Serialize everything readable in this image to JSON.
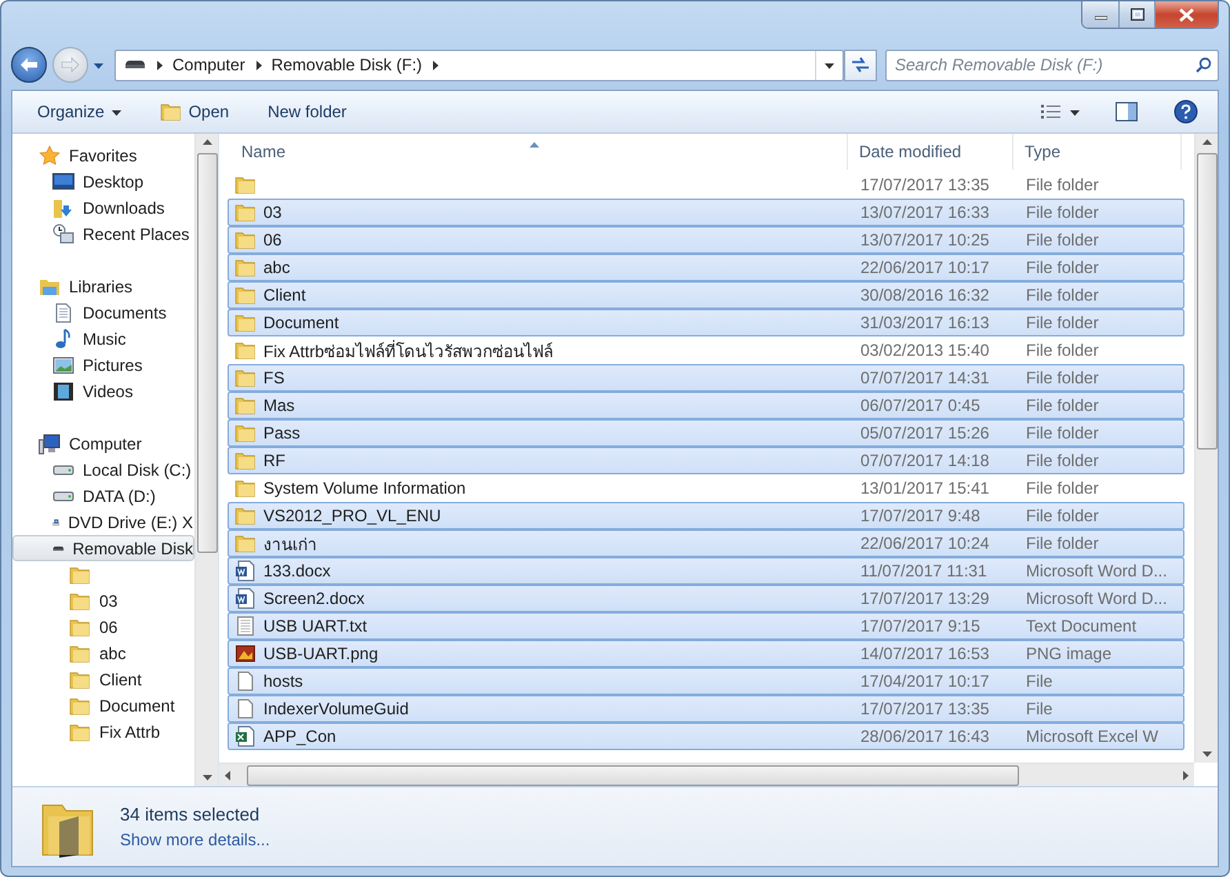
{
  "address": {
    "crumbs": [
      "Computer",
      "Removable Disk (F:)"
    ]
  },
  "search": {
    "placeholder": "Search Removable Disk (F:)"
  },
  "toolbar": {
    "organize": "Organize",
    "open": "Open",
    "new_folder": "New folder"
  },
  "sidebar": [
    {
      "label": "Favorites",
      "kind": "star",
      "selected": false,
      "items": [
        {
          "label": "Desktop",
          "kind": "desktop",
          "selected": false
        },
        {
          "label": "Downloads",
          "kind": "downloads",
          "selected": false
        },
        {
          "label": "Recent Places",
          "kind": "recent",
          "selected": false
        }
      ]
    },
    {
      "label": "Libraries",
      "kind": "library",
      "selected": false,
      "items": [
        {
          "label": "Documents",
          "kind": "document",
          "selected": false
        },
        {
          "label": "Music",
          "kind": "music",
          "selected": false
        },
        {
          "label": "Pictures",
          "kind": "picture",
          "selected": false
        },
        {
          "label": "Videos",
          "kind": "video",
          "selected": false
        }
      ]
    },
    {
      "label": "Computer",
      "kind": "computer",
      "selected": false,
      "items": [
        {
          "label": "Local Disk (C:)",
          "kind": "disk",
          "selected": false
        },
        {
          "label": "DATA (D:)",
          "kind": "disk",
          "selected": false
        },
        {
          "label": "DVD Drive (E:) X",
          "kind": "dvd",
          "selected": false
        },
        {
          "label": "Removable Disk",
          "kind": "removable",
          "selected": true,
          "children": [
            {
              "kind": "folder",
              "selected": false
            },
            {
              "label": "03",
              "kind": "folder",
              "selected": false
            },
            {
              "label": "06",
              "kind": "folder",
              "selected": false
            },
            {
              "label": "abc",
              "kind": "folder",
              "selected": false
            },
            {
              "label": "Client",
              "kind": "folder",
              "selected": false
            },
            {
              "label": "Document",
              "kind": "folder",
              "selected": false
            },
            {
              "label": "Fix Attrb",
              "kind": "folder",
              "selected": false
            }
          ]
        }
      ]
    }
  ],
  "columns": [
    "Name",
    "Date modified",
    "Type"
  ],
  "rows": [
    {
      "date": "17/07/2017 13:35",
      "type": "File folder",
      "kind": "folder",
      "selected": false
    },
    {
      "name": "03",
      "date": "13/07/2017 16:33",
      "type": "File folder",
      "kind": "folder",
      "selected": true
    },
    {
      "name": "06",
      "date": "13/07/2017 10:25",
      "type": "File folder",
      "kind": "folder",
      "selected": true
    },
    {
      "name": "abc",
      "date": "22/06/2017 10:17",
      "type": "File folder",
      "kind": "folder",
      "selected": true
    },
    {
      "name": "Client",
      "date": "30/08/2016 16:32",
      "type": "File folder",
      "kind": "folder",
      "selected": true
    },
    {
      "name": "Document",
      "date": "31/03/2017 16:13",
      "type": "File folder",
      "kind": "folder",
      "selected": true
    },
    {
      "name": "Fix Attrbซ่อมไฟล์ที่โดนไวรัสพวกซ่อนไฟล์",
      "date": "03/02/2013 15:40",
      "type": "File folder",
      "kind": "folder",
      "selected": false
    },
    {
      "name": "FS",
      "date": "07/07/2017 14:31",
      "type": "File folder",
      "kind": "folder",
      "selected": true
    },
    {
      "name": "Mas",
      "date": "06/07/2017 0:45",
      "type": "File folder",
      "kind": "folder",
      "selected": true
    },
    {
      "name": "Pass",
      "date": "05/07/2017 15:26",
      "type": "File folder",
      "kind": "folder",
      "selected": true
    },
    {
      "name": "RF",
      "date": "07/07/2017 14:18",
      "type": "File folder",
      "kind": "folder",
      "selected": true
    },
    {
      "name": "System Volume Information",
      "date": "13/01/2017 15:41",
      "type": "File folder",
      "kind": "folder",
      "selected": false
    },
    {
      "name": "VS2012_PRO_VL_ENU",
      "date": "17/07/2017 9:48",
      "type": "File folder",
      "kind": "folder",
      "selected": true
    },
    {
      "name": "งานเก่า",
      "date": "22/06/2017 10:24",
      "type": "File folder",
      "kind": "folder",
      "selected": true
    },
    {
      "name": "133.docx",
      "date": "11/07/2017 11:31",
      "type": "Microsoft Word D...",
      "kind": "word",
      "selected": true
    },
    {
      "name": "Screen2.docx",
      "date": "17/07/2017 13:29",
      "type": "Microsoft Word D...",
      "kind": "word",
      "selected": true
    },
    {
      "name": "USB UART.txt",
      "date": "17/07/2017 9:15",
      "type": "Text Document",
      "kind": "text",
      "selected": true
    },
    {
      "name": "USB-UART.png",
      "date": "14/07/2017 16:53",
      "type": "PNG image",
      "kind": "image",
      "selected": true
    },
    {
      "name": "hosts",
      "date": "17/04/2017 10:17",
      "type": "File",
      "kind": "file",
      "selected": true
    },
    {
      "name": "IndexerVolumeGuid",
      "date": "17/07/2017 13:35",
      "type": "File",
      "kind": "file",
      "selected": true
    },
    {
      "name": "APP_Con",
      "date": "28/06/2017 16:43",
      "type": "Microsoft Excel W",
      "kind": "excel",
      "selected": true
    }
  ],
  "status": {
    "count": "34 items selected",
    "details": "Show more details..."
  }
}
